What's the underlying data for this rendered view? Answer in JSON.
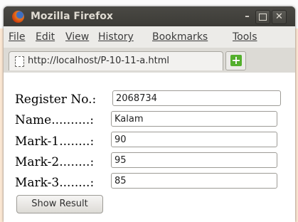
{
  "window": {
    "title": "Mozilla Firefox",
    "minimize_glyph": "–",
    "close_glyph": "✕"
  },
  "menu": {
    "items": [
      {
        "label": "File"
      },
      {
        "label": "Edit"
      },
      {
        "label": "View"
      },
      {
        "label": "History"
      },
      {
        "label": "Bookmarks"
      },
      {
        "label": "Tools"
      }
    ]
  },
  "tabs": {
    "active_label": "http://localhost/P-10-11-a.html",
    "new_tab_glyph": "+"
  },
  "form": {
    "fields": [
      {
        "label": "Register No.:",
        "value": "2068734"
      },
      {
        "label": "Name..........:",
        "value": "Kalam"
      },
      {
        "label": "Mark-1........:",
        "value": "90"
      },
      {
        "label": "Mark-2........:",
        "value": "95"
      },
      {
        "label": "Mark-3........:",
        "value": "85"
      }
    ],
    "submit_label": "Show Result"
  },
  "colors": {
    "titlebar": "#3c3b37",
    "menubar": "#ecebe8",
    "page_background": "#fbe7d3",
    "new_tab_green": "#54b02d"
  },
  "icons": [
    "firefox-logo-icon",
    "page-icon",
    "plus-icon"
  ]
}
